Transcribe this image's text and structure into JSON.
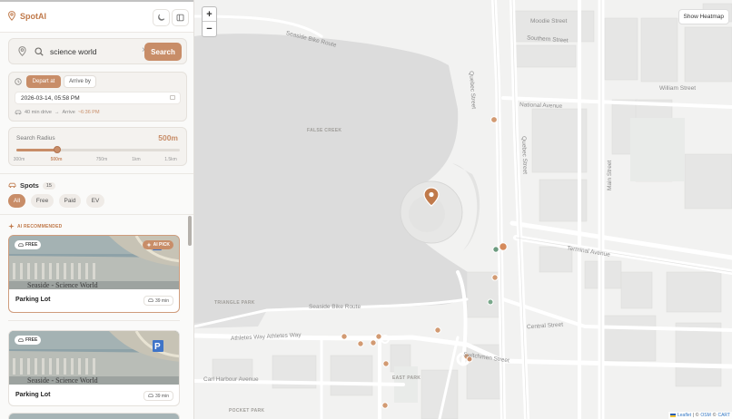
{
  "app": {
    "brand": "SpotAI"
  },
  "search": {
    "value": "science world",
    "button": "Search"
  },
  "time": {
    "depart_label": "Depart at",
    "arrive_label": "Arrive by",
    "datetime": "2026-03-14, 05:58 PM",
    "drive": "40 min drive",
    "arrive_prefix": "Arrive",
    "arrive_time": "~6:36 PM"
  },
  "radius": {
    "title": "Search Radius",
    "value": "500m",
    "slider_fraction": 0.25,
    "ticks": [
      "300m",
      "500m",
      "750m",
      "1km",
      "1.5km"
    ]
  },
  "spots": {
    "title": "Spots",
    "count": "15",
    "filters": [
      "All",
      "Free",
      "Paid",
      "EV"
    ],
    "active_filter": "All",
    "ai_heading": "AI RECOMMENDED",
    "cards": [
      {
        "badge": "FREE",
        "ai_badge": "AI PICK",
        "title": "Parking Lot",
        "time": "39 min",
        "image_caption": "Seaside - Science World"
      },
      {
        "badge": "FREE",
        "title": "Parking Lot",
        "time": "39 min",
        "image_caption": "Seaside - Science World"
      }
    ]
  },
  "map": {
    "heatmap_button": "Show Heatmap",
    "zoom_in": "+",
    "zoom_out": "−",
    "attribution": {
      "leaflet": "Leaflet",
      "sep1": "| ©",
      "osm": "OSM",
      "sep2": "©",
      "carto": "CART"
    },
    "labels": {
      "false_creek": "FALSE CREEK",
      "triangle_park": "TRIANGLE PARK",
      "east_park": "EAST PARK",
      "pocket_park": "POCKET PARK",
      "quebec1": "Quebec Street",
      "quebec2": "Quebec Street",
      "main": "Main Street",
      "national": "National Avenue",
      "terminal": "Terminal Avenue",
      "central": "Central Street",
      "seaside_top": "Seaside Bike Route",
      "seaside_mid": "Seaside Bike Route",
      "athletes": "Athletes Way  Athletes Way",
      "switchmen": "Switchmen Street",
      "harbour": "Carl Harbour Avenue",
      "moodie": "Moodie Street",
      "southern": "Southern Street",
      "william": "William Street"
    }
  },
  "colors": {
    "accent": "#c88d68",
    "brand": "#c07a4b",
    "marker_green": "#6c9b7f"
  }
}
